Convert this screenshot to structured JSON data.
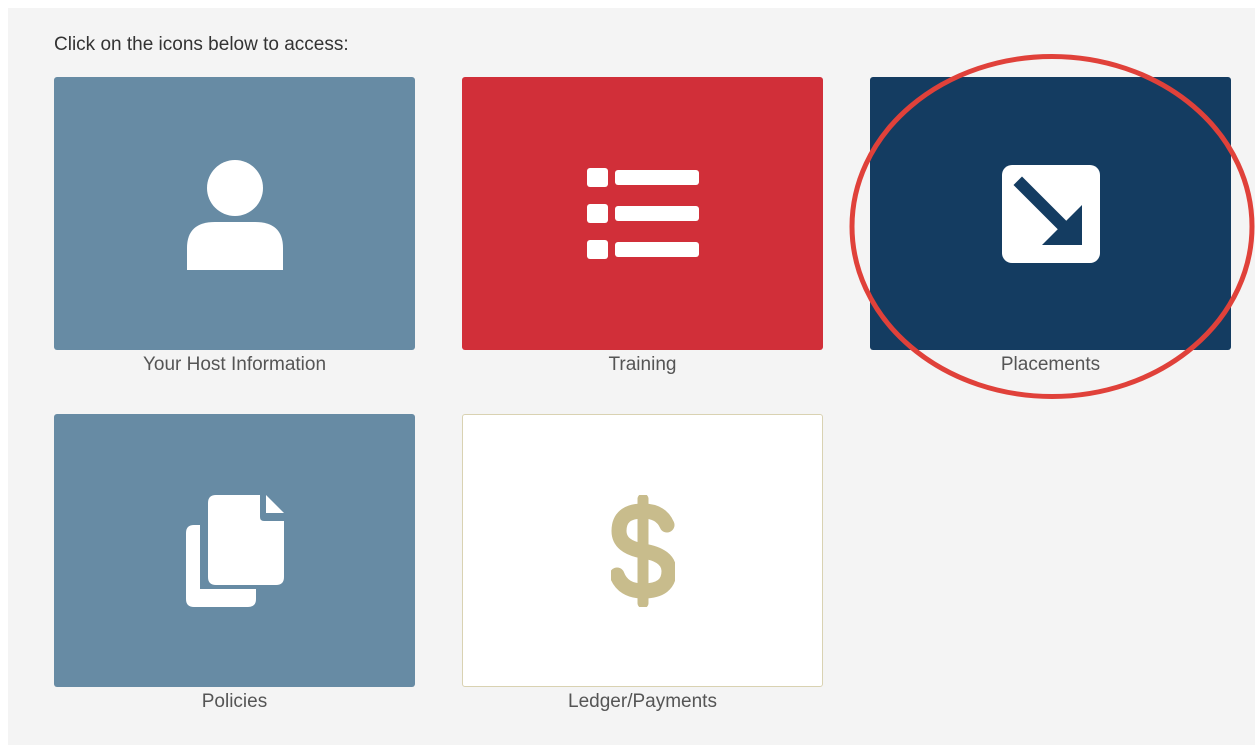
{
  "intro_text": "Click on the icons below to access:",
  "tiles": [
    {
      "label": "Your Host Information",
      "icon": "user-icon",
      "color": "#678ba4"
    },
    {
      "label": "Training",
      "icon": "list-icon",
      "color": "#d12f39"
    },
    {
      "label": "Placements",
      "icon": "arrow-down-right-square-icon",
      "color": "#143c61"
    },
    {
      "label": "Policies",
      "icon": "copy-documents-icon",
      "color": "#678ba4"
    },
    {
      "label": "Ledger/Payments",
      "icon": "dollar-sign-icon",
      "color": "#ffffff"
    }
  ],
  "colors": {
    "page_background": "#f4f4f4",
    "highlight_ring": "#e0413a",
    "dollar_icon": "#c8bc8c"
  }
}
